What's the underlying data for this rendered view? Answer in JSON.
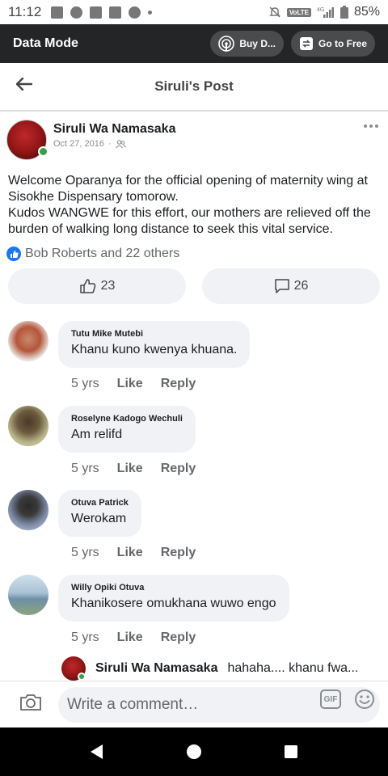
{
  "status_bar": {
    "time": "11:12",
    "network": "4G",
    "volte": "VoLTE",
    "battery": "85%"
  },
  "data_mode": {
    "title": "Data Mode",
    "buy_label": "Buy D...",
    "free_label": "Go to Free"
  },
  "header": {
    "title": "Siruli's Post"
  },
  "post": {
    "author": "Siruli Wa Namasaka",
    "date": "Oct 27, 2016",
    "separator": "·",
    "body_line1": "Welcome Oparanya for the official opening of maternity wing at Sisokhe Dispensary tomorow.",
    "body_line2": "Kudos WANGWE for this effort, our mothers are relieved off the burden of walking long distance to seek this vital service.",
    "reactions_text": "Bob Roberts and 22 others",
    "like_count": "23",
    "comment_count": "26"
  },
  "comments": [
    {
      "name": "Tutu Mike Mutebi",
      "text": "Khanu kuno kwenya khuana.",
      "age": "5 yrs",
      "like": "Like",
      "reply": "Reply"
    },
    {
      "name": "Roselyne Kadogo Wechuli",
      "text": "Am relifd",
      "age": "5 yrs",
      "like": "Like",
      "reply": "Reply"
    },
    {
      "name": "Otuva Patrick",
      "text": "Werokam",
      "age": "5 yrs",
      "like": "Like",
      "reply": "Reply"
    },
    {
      "name": "Willy Opiki Otuva",
      "text": "Khanikosere omukhana wuwo engo",
      "age": "5 yrs",
      "like": "Like",
      "reply": "Reply"
    }
  ],
  "reply_preview": {
    "name": "Siruli Wa Namasaka",
    "text": "hahaha.... khanu fwa..."
  },
  "composer": {
    "placeholder": "Write a comment…",
    "gif": "GIF"
  },
  "colors": {
    "accent": "#1877f2",
    "online": "#31a24c",
    "bubble": "#f0f2f5",
    "data_mode_bg": "#242526"
  }
}
